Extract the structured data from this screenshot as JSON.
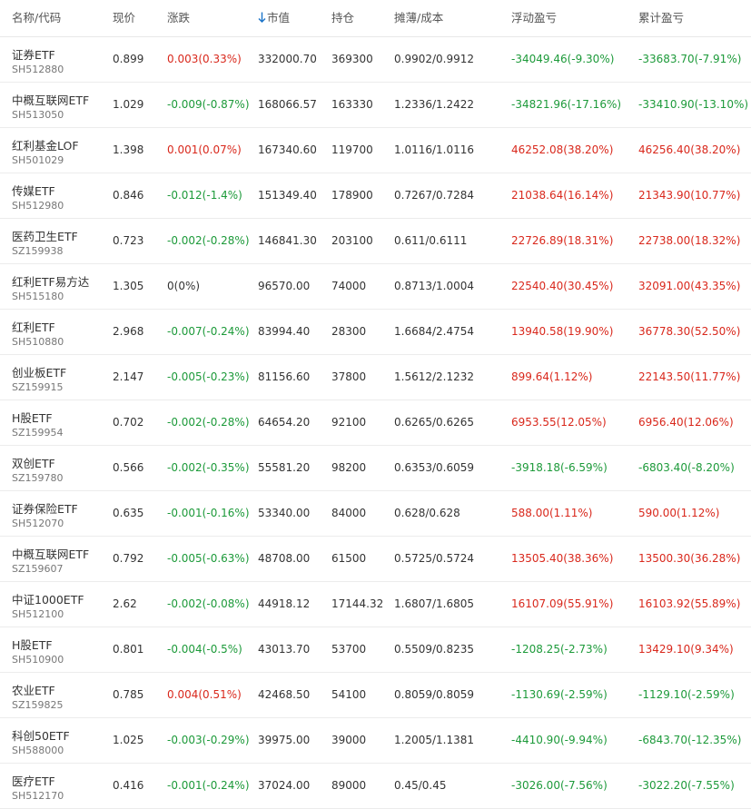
{
  "header": {
    "name": "名称/代码",
    "price": "现价",
    "change": "涨跌",
    "market_value": "市值",
    "position": "持仓",
    "cost": "摊薄/成本",
    "floating_pnl": "浮动盈亏",
    "accumulated_pnl": "累计盈亏"
  },
  "colors": {
    "up": "#d9281c",
    "down": "#1d9a3a",
    "sort_arrow": "#1a73c8"
  },
  "rows": [
    {
      "name": "证券ETF",
      "code": "SH512880",
      "price": "0.899",
      "change": "0.003(0.33%)",
      "change_dir": "up",
      "market_value": "332000.70",
      "position": "369300",
      "cost": "0.9902/0.9912",
      "floating": "-34049.46(-9.30%)",
      "floating_dir": "down",
      "accumulated": "-33683.70(-7.91%)",
      "accumulated_dir": "down"
    },
    {
      "name": "中概互联网ETF",
      "code": "SH513050",
      "price": "1.029",
      "change": "-0.009(-0.87%)",
      "change_dir": "down",
      "market_value": "168066.57",
      "position": "163330",
      "cost": "1.2336/1.2422",
      "floating": "-34821.96(-17.16%)",
      "floating_dir": "down",
      "accumulated": "-33410.90(-13.10%)",
      "accumulated_dir": "down"
    },
    {
      "name": "红利基金LOF",
      "code": "SH501029",
      "price": "1.398",
      "change": "0.001(0.07%)",
      "change_dir": "up",
      "market_value": "167340.60",
      "position": "119700",
      "cost": "1.0116/1.0116",
      "floating": "46252.08(38.20%)",
      "floating_dir": "up",
      "accumulated": "46256.40(38.20%)",
      "accumulated_dir": "up"
    },
    {
      "name": "传媒ETF",
      "code": "SH512980",
      "price": "0.846",
      "change": "-0.012(-1.4%)",
      "change_dir": "down",
      "market_value": "151349.40",
      "position": "178900",
      "cost": "0.7267/0.7284",
      "floating": "21038.64(16.14%)",
      "floating_dir": "up",
      "accumulated": "21343.90(10.77%)",
      "accumulated_dir": "up"
    },
    {
      "name": "医药卫生ETF",
      "code": "SZ159938",
      "price": "0.723",
      "change": "-0.002(-0.28%)",
      "change_dir": "down",
      "market_value": "146841.30",
      "position": "203100",
      "cost": "0.611/0.6111",
      "floating": "22726.89(18.31%)",
      "floating_dir": "up",
      "accumulated": "22738.00(18.32%)",
      "accumulated_dir": "up"
    },
    {
      "name": "红利ETF易方达",
      "code": "SH515180",
      "price": "1.305",
      "change": "0(0%)",
      "change_dir": "flat",
      "market_value": "96570.00",
      "position": "74000",
      "cost": "0.8713/1.0004",
      "floating": "22540.40(30.45%)",
      "floating_dir": "up",
      "accumulated": "32091.00(43.35%)",
      "accumulated_dir": "up"
    },
    {
      "name": "红利ETF",
      "code": "SH510880",
      "price": "2.968",
      "change": "-0.007(-0.24%)",
      "change_dir": "down",
      "market_value": "83994.40",
      "position": "28300",
      "cost": "1.6684/2.4754",
      "floating": "13940.58(19.90%)",
      "floating_dir": "up",
      "accumulated": "36778.30(52.50%)",
      "accumulated_dir": "up"
    },
    {
      "name": "创业板ETF",
      "code": "SZ159915",
      "price": "2.147",
      "change": "-0.005(-0.23%)",
      "change_dir": "down",
      "market_value": "81156.60",
      "position": "37800",
      "cost": "1.5612/2.1232",
      "floating": "899.64(1.12%)",
      "floating_dir": "up",
      "accumulated": "22143.50(11.77%)",
      "accumulated_dir": "up"
    },
    {
      "name": "H股ETF",
      "code": "SZ159954",
      "price": "0.702",
      "change": "-0.002(-0.28%)",
      "change_dir": "down",
      "market_value": "64654.20",
      "position": "92100",
      "cost": "0.6265/0.6265",
      "floating": "6953.55(12.05%)",
      "floating_dir": "up",
      "accumulated": "6956.40(12.06%)",
      "accumulated_dir": "up"
    },
    {
      "name": "双创ETF",
      "code": "SZ159780",
      "price": "0.566",
      "change": "-0.002(-0.35%)",
      "change_dir": "down",
      "market_value": "55581.20",
      "position": "98200",
      "cost": "0.6353/0.6059",
      "floating": "-3918.18(-6.59%)",
      "floating_dir": "down",
      "accumulated": "-6803.40(-8.20%)",
      "accumulated_dir": "down"
    },
    {
      "name": "证券保险ETF",
      "code": "SH512070",
      "price": "0.635",
      "change": "-0.001(-0.16%)",
      "change_dir": "down",
      "market_value": "53340.00",
      "position": "84000",
      "cost": "0.628/0.628",
      "floating": "588.00(1.11%)",
      "floating_dir": "up",
      "accumulated": "590.00(1.12%)",
      "accumulated_dir": "up"
    },
    {
      "name": "中概互联网ETF",
      "code": "SZ159607",
      "price": "0.792",
      "change": "-0.005(-0.63%)",
      "change_dir": "down",
      "market_value": "48708.00",
      "position": "61500",
      "cost": "0.5725/0.5724",
      "floating": "13505.40(38.36%)",
      "floating_dir": "up",
      "accumulated": "13500.30(36.28%)",
      "accumulated_dir": "up"
    },
    {
      "name": "中证1000ETF",
      "code": "SH512100",
      "price": "2.62",
      "change": "-0.002(-0.08%)",
      "change_dir": "down",
      "market_value": "44918.12",
      "position": "17144.32",
      "cost": "1.6807/1.6805",
      "floating": "16107.09(55.91%)",
      "floating_dir": "up",
      "accumulated": "16103.92(55.89%)",
      "accumulated_dir": "up"
    },
    {
      "name": "H股ETF",
      "code": "SH510900",
      "price": "0.801",
      "change": "-0.004(-0.5%)",
      "change_dir": "down",
      "market_value": "43013.70",
      "position": "53700",
      "cost": "0.5509/0.8235",
      "floating": "-1208.25(-2.73%)",
      "floating_dir": "down",
      "accumulated": "13429.10(9.34%)",
      "accumulated_dir": "up"
    },
    {
      "name": "农业ETF",
      "code": "SZ159825",
      "price": "0.785",
      "change": "0.004(0.51%)",
      "change_dir": "up",
      "market_value": "42468.50",
      "position": "54100",
      "cost": "0.8059/0.8059",
      "floating": "-1130.69(-2.59%)",
      "floating_dir": "down",
      "accumulated": "-1129.10(-2.59%)",
      "accumulated_dir": "down"
    },
    {
      "name": "科创50ETF",
      "code": "SH588000",
      "price": "1.025",
      "change": "-0.003(-0.29%)",
      "change_dir": "down",
      "market_value": "39975.00",
      "position": "39000",
      "cost": "1.2005/1.1381",
      "floating": "-4410.90(-9.94%)",
      "floating_dir": "down",
      "accumulated": "-6843.70(-12.35%)",
      "accumulated_dir": "down"
    },
    {
      "name": "医疗ETF",
      "code": "SH512170",
      "price": "0.416",
      "change": "-0.001(-0.24%)",
      "change_dir": "down",
      "market_value": "37024.00",
      "position": "89000",
      "cost": "0.45/0.45",
      "floating": "-3026.00(-7.56%)",
      "floating_dir": "down",
      "accumulated": "-3022.20(-7.55%)",
      "accumulated_dir": "down"
    }
  ]
}
